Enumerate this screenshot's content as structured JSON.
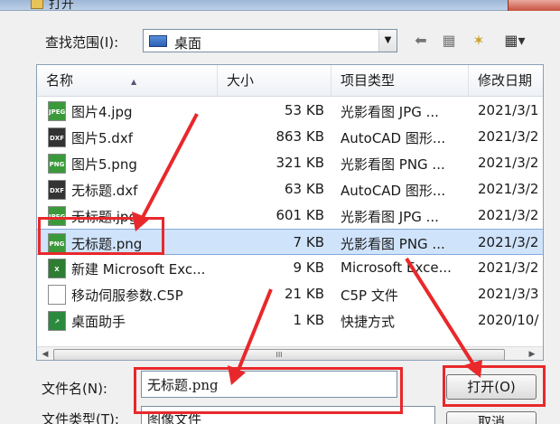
{
  "window": {
    "title": "打开"
  },
  "lookin": {
    "label": "查找范围(I):",
    "value": "桌面",
    "dropdown_glyph": "▼"
  },
  "toolbar": {
    "back_glyph": "⬅",
    "up_glyph": "▦",
    "newfolder_glyph": "✶",
    "views_glyph": "▦▾"
  },
  "columns": {
    "name": "名称",
    "size": "大小",
    "type": "项目类型",
    "date": "修改日期",
    "sort_glyph": "▲"
  },
  "files": [
    {
      "name": "图片4.jpg",
      "size": "53 KB",
      "type": "光影看图 JPG ...",
      "date": "2021/3/1",
      "icon": "jpeg-file-icon",
      "icon_label": "JPEG",
      "icon_color": "#3a9a3a"
    },
    {
      "name": "图片5.dxf",
      "size": "863 KB",
      "type": "AutoCAD 图形...",
      "date": "2021/3/2",
      "icon": "dxf-file-icon",
      "icon_label": "DXF",
      "icon_color": "#333333"
    },
    {
      "name": "图片5.png",
      "size": "321 KB",
      "type": "光影看图 PNG ...",
      "date": "2021/3/2",
      "icon": "png-file-icon",
      "icon_label": "PNG",
      "icon_color": "#3a9a3a"
    },
    {
      "name": "无标题.dxf",
      "size": "63 KB",
      "type": "AutoCAD 图形...",
      "date": "2021/3/2",
      "icon": "dxf-file-icon",
      "icon_label": "DXF",
      "icon_color": "#333333"
    },
    {
      "name": "无标题.jpg",
      "size": "601 KB",
      "type": "光影看图 JPG ...",
      "date": "2021/3/2",
      "icon": "jpeg-file-icon",
      "icon_label": "JPEG",
      "icon_color": "#3a9a3a"
    },
    {
      "name": "无标题.png",
      "size": "7 KB",
      "type": "光影看图 PNG ...",
      "date": "2021/3/2",
      "icon": "png-file-icon",
      "icon_label": "PNG",
      "icon_color": "#3a9a3a"
    },
    {
      "name": "新建 Microsoft Exc...",
      "size": "9 KB",
      "type": "Microsoft Exce...",
      "date": "2021/3/2",
      "icon": "excel-file-icon",
      "icon_label": "X",
      "icon_color": "#2e7d32"
    },
    {
      "name": "移动伺服参数.C5P",
      "size": "21 KB",
      "type": "C5P 文件",
      "date": "2021/3/3",
      "icon": "generic-file-icon",
      "icon_label": "",
      "icon_color": "#ffffff"
    },
    {
      "name": "桌面助手",
      "size": "1 KB",
      "type": "快捷方式",
      "date": "2020/10/",
      "icon": "shortcut-icon",
      "icon_label": "↗",
      "icon_color": "#2b8a3e"
    }
  ],
  "selected_index": 5,
  "hscroll": {
    "thumb_glyph": "III",
    "left_glyph": "◀",
    "right_glyph": "▶"
  },
  "filename": {
    "label": "文件名(N):",
    "value": "无标题.png"
  },
  "filetype": {
    "label": "文件类型(T):",
    "value": "图像文件"
  },
  "buttons": {
    "open": "打开(O)",
    "cancel": "取消"
  },
  "accent_color": "#e8282b"
}
